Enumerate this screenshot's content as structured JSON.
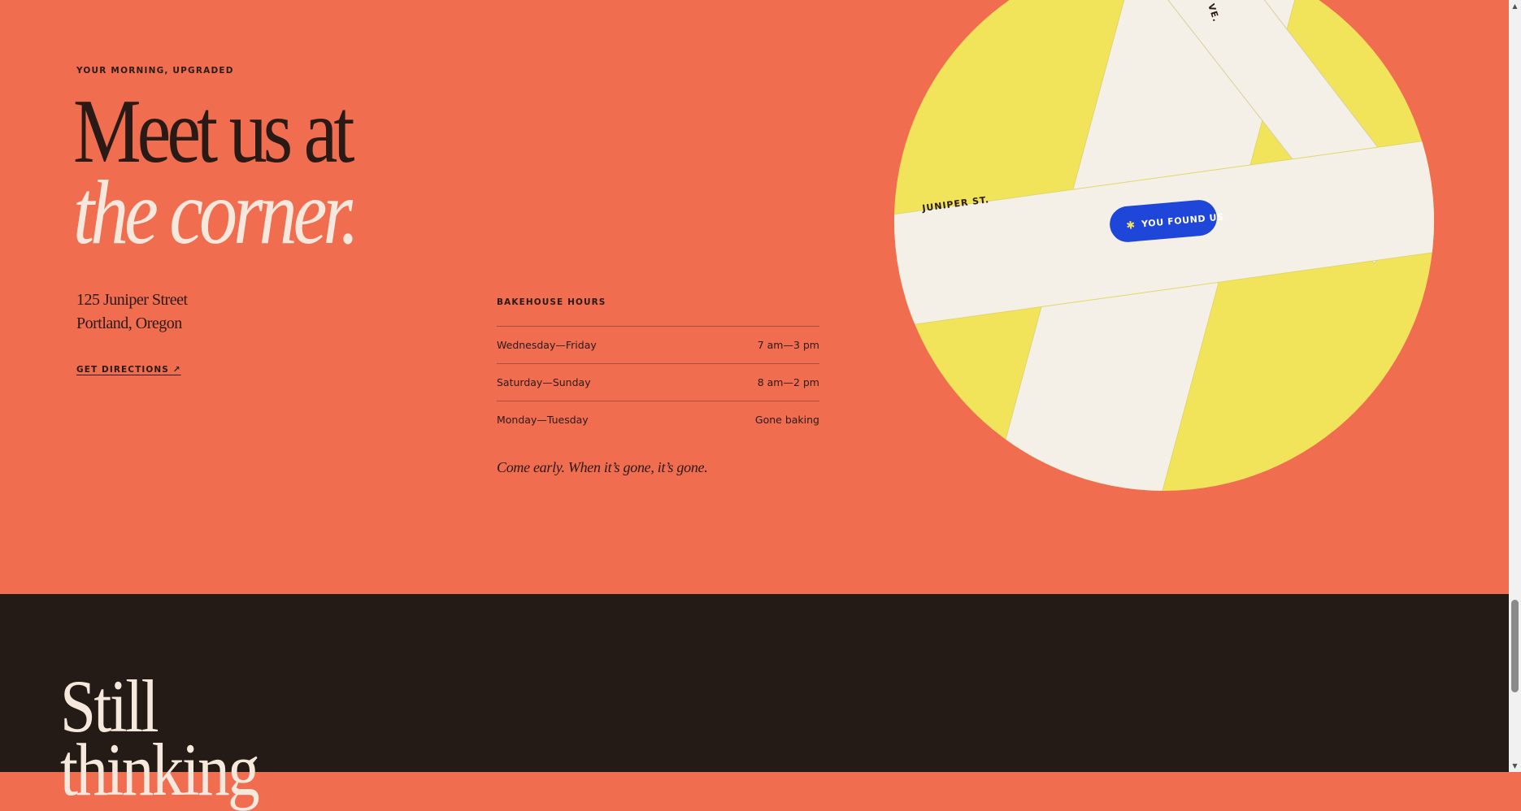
{
  "hero": {
    "eyebrow": "YOUR MORNING, UPGRADED",
    "headline_line1": "Meet us at",
    "headline_line2": "the corner.",
    "address_line1": "125 Juniper Street",
    "address_line2": "Portland, Oregon",
    "directions_link": "GET DIRECTIONS ↗"
  },
  "hours": {
    "title": "BAKEHOUSE HOURS",
    "rows": [
      {
        "days": "Wednesday—Friday",
        "time": "7 am—3 pm"
      },
      {
        "days": "Saturday—Sunday",
        "time": "8 am—2 pm"
      },
      {
        "days": "Monday—Tuesday",
        "time": "Gone baking"
      }
    ],
    "note": "Come early. When it’s gone, it’s gone."
  },
  "map": {
    "street_label": "JUNIPER ST.",
    "avenue_label": "VE.",
    "pin_label": "YOU FOUND US",
    "pin_icon": "star-icon",
    "colors": {
      "block": "#f2e45a",
      "street": "#f5f0e7",
      "pin": "#1e46d8"
    }
  },
  "next_section": {
    "title_line1": "Still",
    "title_line2": "thinking"
  },
  "scrollbar": {
    "up_icon": "▲",
    "down_icon": "▼"
  },
  "colors": {
    "coral": "#f06d50",
    "dark": "#241b17",
    "cream": "#f6e8dc",
    "ink": "#2a1a15"
  }
}
